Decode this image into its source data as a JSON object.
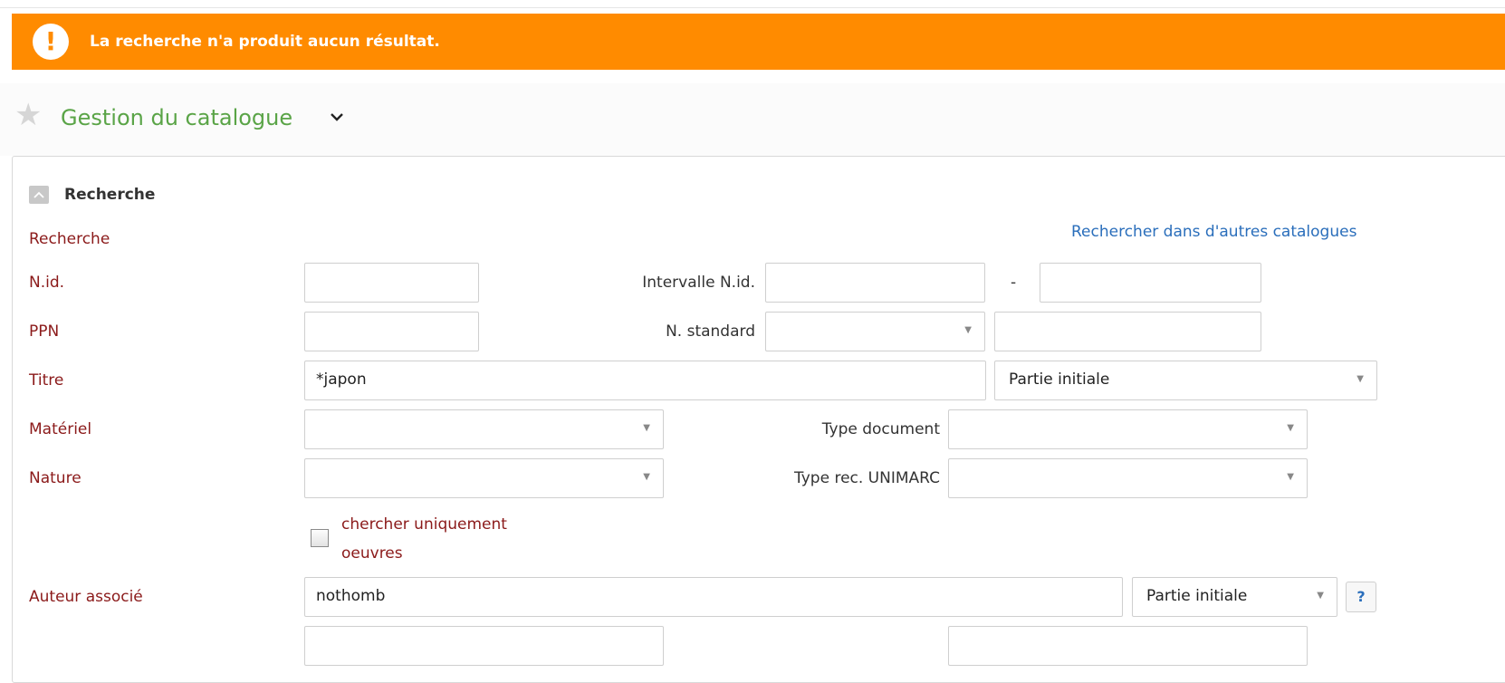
{
  "alert": {
    "icon": "exclamation-icon",
    "message": "La recherche n'a produit aucun résultat."
  },
  "header": {
    "title": "Gestion du catalogue"
  },
  "panel": {
    "section_title": "Recherche",
    "search_label": "Recherche",
    "other_catalogs_link": "Rechercher dans d'autres catalogues",
    "fields": {
      "nid_label": "N.id.",
      "nid_value": "",
      "nid_range_label": "Intervalle N.id.",
      "nid_range_from": "",
      "nid_range_sep": "-",
      "nid_range_to": "",
      "ppn_label": "PPN",
      "ppn_value": "",
      "standard_label": "N. standard",
      "standard_select": "",
      "standard_value": "",
      "title_label": "Titre",
      "title_value": "*japon",
      "title_mode": "Partie initiale",
      "material_label": "Matériel",
      "material_value": "",
      "doc_type_label": "Type document",
      "doc_type_value": "",
      "nature_label": "Nature",
      "nature_value": "",
      "unimarc_label": "Type rec. UNIMARC",
      "unimarc_value": "",
      "only_works_label_line1": "chercher uniquement",
      "only_works_label_line2": "oeuvres",
      "only_works_checked": false,
      "author_label": "Auteur associé",
      "author_value": "nothomb",
      "author_mode": "Partie initiale",
      "help_label": "?"
    }
  },
  "colors": {
    "alert_bg": "#ff8b00",
    "title_green": "#5aa447",
    "label_red": "#8b1a1a",
    "link_blue": "#2a6ebb"
  }
}
